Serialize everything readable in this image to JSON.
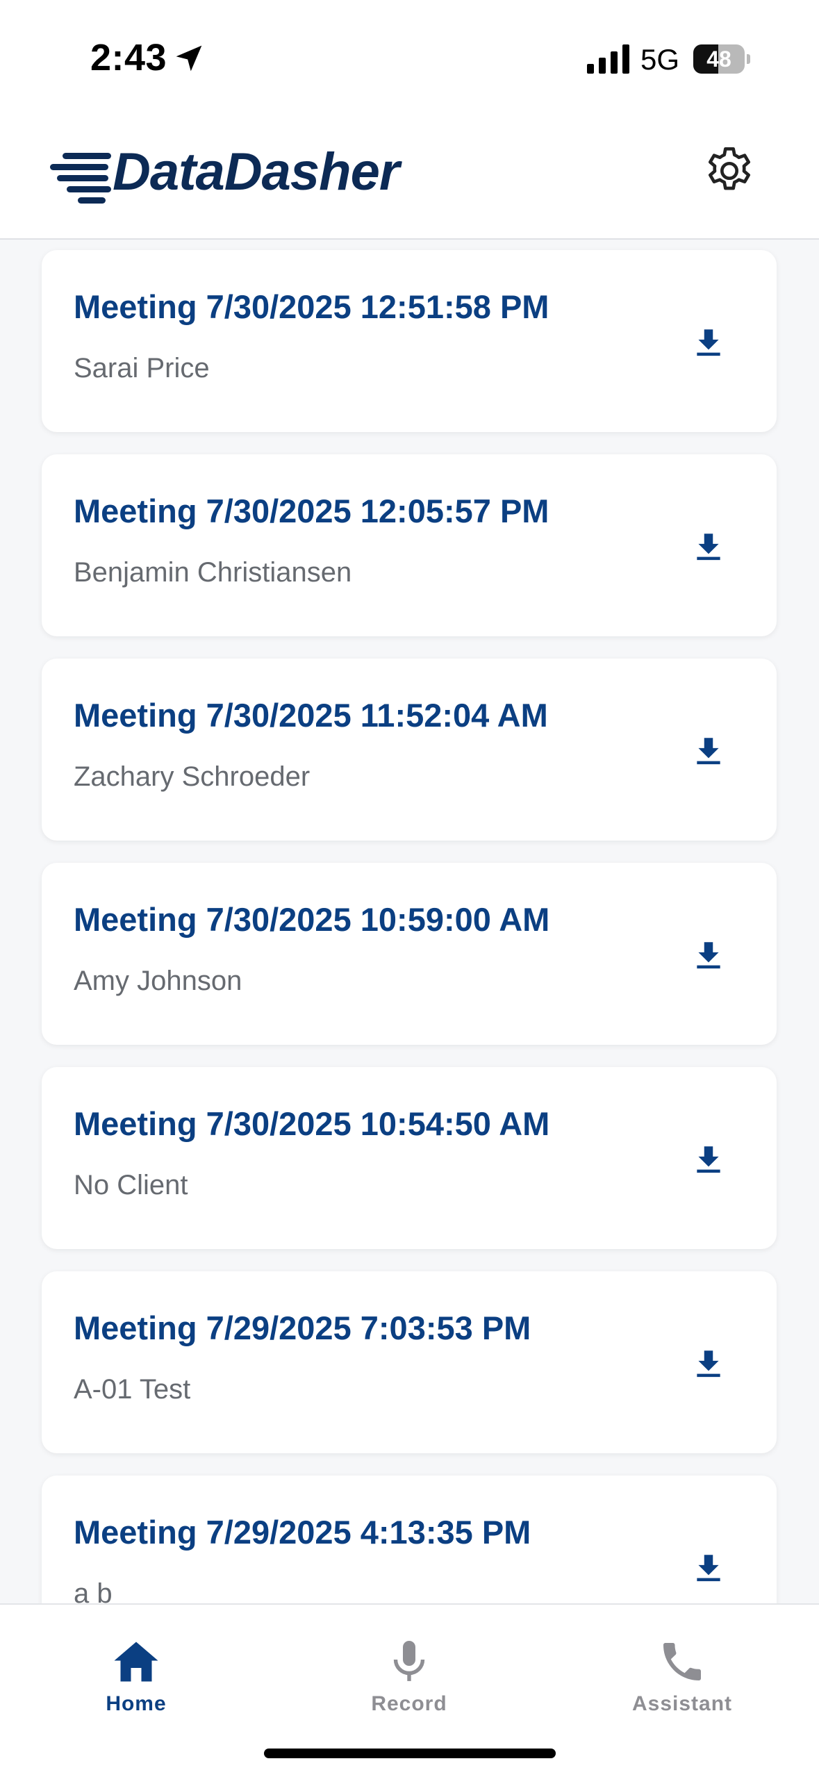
{
  "status_bar": {
    "time": "2:43",
    "network": "5G",
    "battery": "48"
  },
  "header": {
    "app_name": "DataDasher",
    "brand_color": "#0c2a55"
  },
  "meetings": [
    {
      "title": "Meeting 7/30/2025 12:51:58 PM",
      "client": "Sarai Price"
    },
    {
      "title": "Meeting 7/30/2025 12:05:57 PM",
      "client": "Benjamin Christiansen"
    },
    {
      "title": "Meeting 7/30/2025 11:52:04 AM",
      "client": "Zachary Schroeder"
    },
    {
      "title": "Meeting 7/30/2025 10:59:00 AM",
      "client": "Amy Johnson"
    },
    {
      "title": "Meeting 7/30/2025 10:54:50 AM",
      "client": "No Client"
    },
    {
      "title": "Meeting 7/29/2025 7:03:53 PM",
      "client": "A-01 Test"
    },
    {
      "title": "Meeting 7/29/2025 4:13:35 PM",
      "client": "a b"
    }
  ],
  "nav": {
    "home": "Home",
    "record": "Record",
    "assistant": "Assistant",
    "active": "home",
    "active_color": "#0b3f82",
    "inactive_color": "#8e8e93"
  }
}
